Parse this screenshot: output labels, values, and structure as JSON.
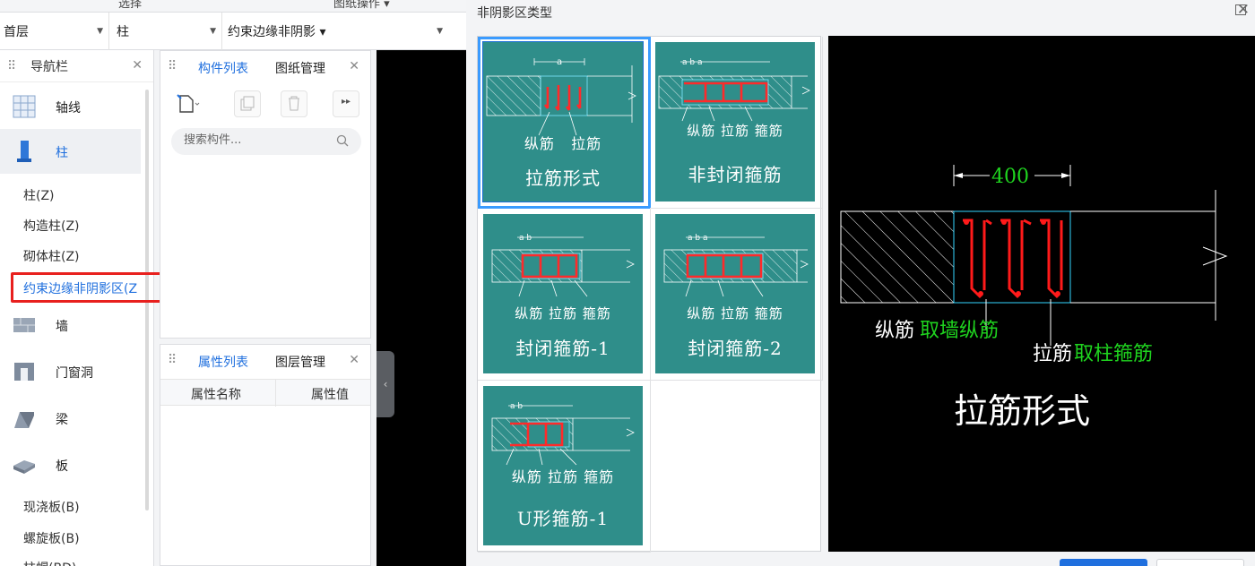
{
  "ribbon": {
    "left_label": "选择",
    "right_label": "图纸操作 ▾"
  },
  "selectors": {
    "floor": "首层",
    "type": "柱",
    "subtype": "约束边缘非阴影 ▾"
  },
  "nav": {
    "title": "导航栏",
    "items": [
      {
        "label": "轴线",
        "icon": "grid-icon"
      },
      {
        "label": "柱",
        "icon": "column-icon"
      }
    ],
    "column_subitems": [
      "柱(Z)",
      "构造柱(Z)",
      "砌体柱(Z)",
      "约束边缘非阴影区(Z"
    ],
    "items2": [
      {
        "label": "墙",
        "icon": "wall-icon"
      },
      {
        "label": "门窗洞",
        "icon": "door-icon"
      },
      {
        "label": "梁",
        "icon": "beam-icon"
      },
      {
        "label": "板",
        "icon": "slab-icon"
      }
    ],
    "slab_subitems": [
      "现浇板(B)",
      "螺旋板(B)",
      "柱帽(BD)"
    ]
  },
  "component_panel": {
    "tabs": [
      "构件列表",
      "图纸管理"
    ],
    "search_placeholder": "搜索构件..."
  },
  "property_panel": {
    "tabs": [
      "属性列表",
      "图层管理"
    ],
    "columns": [
      "属性名称",
      "属性值"
    ]
  },
  "dialog": {
    "title": "非阴影区类型",
    "options": [
      {
        "label": "拉筋形式",
        "labels": [
          "纵筋",
          "拉筋"
        ],
        "dim": "a"
      },
      {
        "label": "非封闭箍筋",
        "labels": [
          "纵筋",
          "拉筋",
          "箍筋"
        ],
        "dim": "a b a"
      },
      {
        "label": "封闭箍筋-1",
        "labels": [
          "纵筋",
          "拉筋",
          "箍筋"
        ],
        "dim": "a b"
      },
      {
        "label": "封闭箍筋-2",
        "labels": [
          "纵筋",
          "拉筋",
          "箍筋"
        ],
        "dim": "a b a"
      },
      {
        "label": "U形箍筋-1",
        "labels": [
          "纵筋",
          "拉筋",
          "箍筋"
        ],
        "dim": "a b"
      }
    ],
    "preview": {
      "dimension": "400",
      "label_long": "纵筋",
      "label_long_note": "取墙纵筋",
      "label_tie": "拉筋",
      "label_tie_note": "取柱箍筋",
      "caption": "拉筋形式",
      "note_color": "#1fd41f"
    }
  },
  "colors": {
    "accent": "#1f6fde",
    "highlight": "#e8201e",
    "tile": "#2f8e8a",
    "selected": "#3a9bff"
  }
}
